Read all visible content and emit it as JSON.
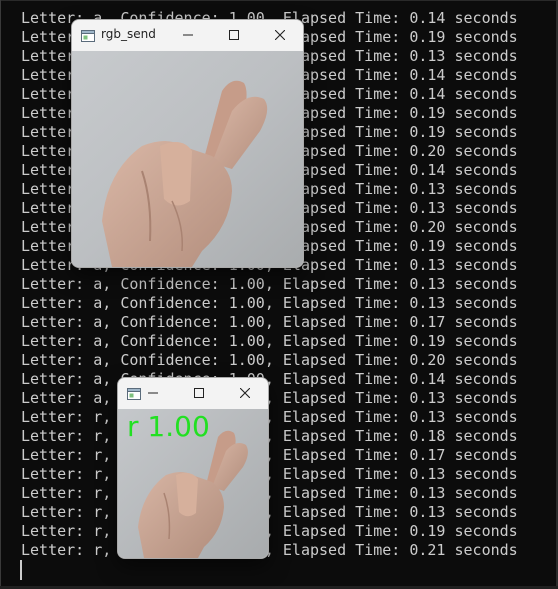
{
  "terminal": {
    "lines": [
      "Letter: a, Confidence: 1.00, Elapsed Time: 0.14 seconds",
      "Letter: a, Confidence: 1.00, Elapsed Time: 0.19 seconds",
      "Letter: a, Confidence: 1.00, Elapsed Time: 0.13 seconds",
      "Letter: a, Confidence: 1.00, Elapsed Time: 0.14 seconds",
      "Letter: a, Confidence: 1.00, Elapsed Time: 0.14 seconds",
      "Letter: a, Confidence: 1.00, Elapsed Time: 0.19 seconds",
      "Letter: a, Confidence: 1.00, Elapsed Time: 0.19 seconds",
      "Letter: a, Confidence: 1.00, Elapsed Time: 0.20 seconds",
      "Letter: a, Confidence: 1.00, Elapsed Time: 0.14 seconds",
      "Letter: a, Confidence: 1.00, Elapsed Time: 0.13 seconds",
      "Letter: a, Confidence: 1.00, Elapsed Time: 0.13 seconds",
      "Letter: a, Confidence: 1.00, Elapsed Time: 0.20 seconds",
      "Letter: a, Confidence: 1.00, Elapsed Time: 0.19 seconds",
      "Letter: a, Confidence: 1.00, Elapsed Time: 0.13 seconds",
      "Letter: a, Confidence: 1.00, Elapsed Time: 0.13 seconds",
      "Letter: a, Confidence: 1.00, Elapsed Time: 0.13 seconds",
      "Letter: a, Confidence: 1.00, Elapsed Time: 0.17 seconds",
      "Letter: a, Confidence: 1.00, Elapsed Time: 0.19 seconds",
      "Letter: a, Confidence: 1.00, Elapsed Time: 0.20 seconds",
      "Letter: a, Confidence: 1.00, Elapsed Time: 0.14 seconds",
      "Letter: a, Confidence: 1.00, Elapsed Time: 0.13 seconds",
      "Letter: r, Confidence: 1.00, Elapsed Time: 0.13 seconds",
      "Letter: r, Confidence: 1.00, Elapsed Time: 0.18 seconds",
      "Letter: r, Confidence: 1.00, Elapsed Time: 0.17 seconds",
      "Letter: r, Confidence: 1.00, Elapsed Time: 0.13 seconds",
      "Letter: r, Confidence: 1.00, Elapsed Time: 0.13 seconds",
      "Letter: r, Confidence: 1.00, Elapsed Time: 0.13 seconds",
      "Letter: r, Confidence: 1.00, Elapsed Time: 0.19 seconds",
      "Letter: r, Confidence: 1.00, Elapsed Time: 0.21 seconds"
    ]
  },
  "window_rgb_send": {
    "title": "rgb_send",
    "icon": "app-window-icon"
  },
  "window_overlay": {
    "title": "",
    "icon": "app-window-icon",
    "overlay_text": "r 1.00",
    "overlay_color": "#22e022"
  },
  "colors": {
    "terminal_bg": "#0c0c0c",
    "terminal_fg": "#cccccc",
    "titlebar_bg": "#f3f3f3"
  }
}
